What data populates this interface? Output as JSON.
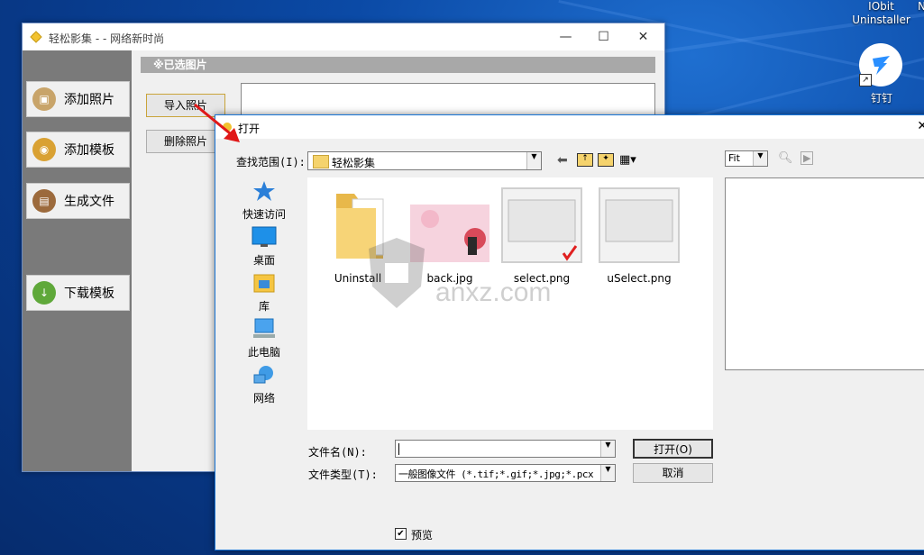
{
  "desktop": {
    "iobit_label_1": "IObit",
    "iobit_label_2": "Uninstaller",
    "ding_label": "钉钉",
    "edge_letter": "N"
  },
  "app": {
    "title": "轻松影集 - - 网络新时尚",
    "nav": [
      {
        "label": "添加照片"
      },
      {
        "label": "添加模板"
      },
      {
        "label": "生成文件"
      },
      {
        "label": "下载模板"
      }
    ],
    "selected_header": "※已选图片",
    "import_button": "导入照片",
    "delete_button": "删除照片"
  },
  "dialog": {
    "title": "打开",
    "look_in_label": "查找范围(I):",
    "look_in_value": "轻松影集",
    "zoom_value": "Fit",
    "places": [
      {
        "label": "快速访问"
      },
      {
        "label": "桌面"
      },
      {
        "label": "库"
      },
      {
        "label": "此电脑"
      },
      {
        "label": "网络"
      }
    ],
    "files": [
      {
        "name": "Uninstall"
      },
      {
        "name": "back.jpg"
      },
      {
        "name": "select.png"
      },
      {
        "name": "uSelect.png"
      }
    ],
    "filename_label": "文件名(N):",
    "filename_value": "",
    "filetype_label": "文件类型(T):",
    "filetype_value": "一般图像文件 (*.tif;*.gif;*.jpg;*.pcx",
    "open_button": "打开(O)",
    "cancel_button": "取消",
    "preview_label": "预览",
    "preview_checked": true
  },
  "watermark": {
    "text": "anxz.com"
  }
}
